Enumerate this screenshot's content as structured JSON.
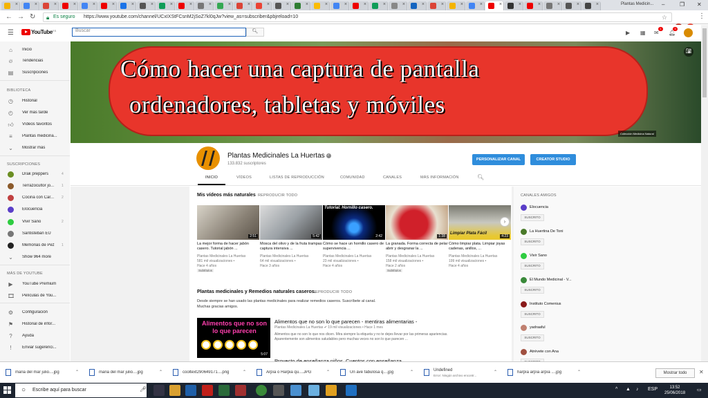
{
  "browser": {
    "window_title": "Plantas Medicin...",
    "address": {
      "secure_label": "Es seguro",
      "url": "https://www.youtube.com/channel/UCxIXStFCsnM2jSoZ7kl0qJw?view_as=subscriber&pbjreload=10"
    }
  },
  "youtube": {
    "logo_text": "YouTube",
    "logo_region": "ES",
    "search_placeholder": "Buscar",
    "notification_count": "3",
    "messages_count": "1"
  },
  "sidebar": {
    "main": [
      {
        "label": "Inicio",
        "icon": "home-icon"
      },
      {
        "label": "Tendencias",
        "icon": "trending-icon"
      },
      {
        "label": "Suscripciones",
        "icon": "subscriptions-icon"
      }
    ],
    "library_header": "BIBLIOTECA",
    "library": [
      {
        "label": "Historial",
        "icon": "history-icon"
      },
      {
        "label": "Ver más tarde",
        "icon": "clock-icon"
      },
      {
        "label": "Vídeos favoritos",
        "icon": "thumbs-up-icon"
      },
      {
        "label": "Plantas medicina...",
        "icon": "playlist-icon"
      },
      {
        "label": "Mostrar más",
        "icon": "chevron-down-icon"
      }
    ],
    "subs_header": "SUSCRIPCIONES",
    "subscriptions": [
      {
        "label": "Drak preppers",
        "count": "4",
        "color": "#6b8e23"
      },
      {
        "label": "Terrazocultor jo...",
        "count": "1",
        "color": "#8b5a2b"
      },
      {
        "label": "Cocina con Car...",
        "count": "2",
        "color": "#c04040"
      },
      {
        "label": "Elocuencia",
        "count": "",
        "color": "#5a3ec8"
      },
      {
        "label": "Vivir Sano",
        "count": "2",
        "color": "#2ecc40"
      },
      {
        "label": "Santisteban EU",
        "count": "",
        "color": "#777777"
      },
      {
        "label": "Memorias de Pez",
        "count": "1",
        "color": "#222222"
      },
      {
        "label": "Show 964 more",
        "count": "",
        "color": ""
      }
    ],
    "more_header": "MÁS DE YOUTUBE",
    "more": [
      {
        "label": "YouTube Premium",
        "icon": "youtube-icon"
      },
      {
        "label": "Películas de You...",
        "icon": "film-icon"
      }
    ],
    "settings": [
      {
        "label": "Configuración",
        "icon": "gear-icon"
      },
      {
        "label": "Historial de infor...",
        "icon": "flag-icon"
      },
      {
        "label": "Ayuda",
        "icon": "help-icon"
      },
      {
        "label": "Enviar sugerenci...",
        "icon": "feedback-icon"
      }
    ]
  },
  "banner": {
    "line1": "Cómo hacer una captura de pantalla",
    "line2": "ordenadores, tabletas y móviles",
    "collection": "Colección Medicina Natural"
  },
  "channel": {
    "name": "Plantas Medicinales La Huertas",
    "subscribers": "133.832 suscriptores",
    "customize_label": "PERSONALIZAR CANAL",
    "studio_label": "CREATOR STUDIO",
    "tabs": [
      "INICIO",
      "VÍDEOS",
      "LISTAS DE REPRODUCCIÓN",
      "COMUNIDAD",
      "CANALES",
      "MÁS INFORMACIÓN"
    ]
  },
  "section1": {
    "title": "Mis vídeos más naturales",
    "play_all": "REPRODUCIR TODO",
    "videos": [
      {
        "title": "La mejor forma de hacer jabón casero. Tutorial jabón ...",
        "channel": "Plantas Medicinales La Huertas",
        "views": "581 mil visualizaciones •",
        "age": "Hace 4 años",
        "duration": "2:51",
        "tag": "Subtítulos"
      },
      {
        "title": "Mosca del olivo y de la fruta trampas captura intensiva ...",
        "channel": "Plantas Medicinales La Huertas",
        "views": "64 mil visualizaciones •",
        "age": "Hace 3 años",
        "duration": "5:42",
        "tag": ""
      },
      {
        "title": "Cómo se hace un hornillo casero de supervivencia ...",
        "channel": "Plantas Medicinales La Huertas",
        "views": "23 mil visualizaciones •",
        "age": "Hace 4 años",
        "duration": "2:42",
        "tag": "",
        "thumb_text": "Tutorial. Hornillo casero."
      },
      {
        "title": "La granada. Forma correcta de pelar abrir y desgranar la ...",
        "channel": "Plantas Medicinales La Huertas",
        "views": "158 mil visualizaciones •",
        "age": "Hace 2 años",
        "duration": "1:38",
        "tag": "Subtítulos"
      },
      {
        "title": "Cómo limpiar plata. Limpiar joyas cadenas, anillos, ...",
        "channel": "Plantas Medicinales La Huertas",
        "views": "199 mil visualizaciones •",
        "age": "Hace 4 años",
        "duration": "4:23",
        "tag": "",
        "thumb_text": "Limpiar Plata Fácil"
      }
    ]
  },
  "section2": {
    "title": "Plantas medicinales y Remedios naturales caseros.",
    "play_all": "REPRODUCIR TODO",
    "description": "Desde siempre se han usado las plantas medicinales para realizar remedios caseros. Suscríbete al canal. Muchas gracias amigos.",
    "feature": {
      "thumb_text": "Alimentos que no son lo que parecen",
      "duration": "5:07",
      "title": "Alimentos que no son lo que parecen - mentiras alimentarias -",
      "meta": "Plantas Medicinales La Huertas  ✔  19 mil visualizaciones • Hace 1 mes",
      "description": "Alimentos que no son lo que nos dicen. Mira siempre la etiqueta y no te dejes llevar por las primeras apariencias. Aparentemente son alimentos saludables pero muchas veces no son lo que parecen ...",
      "next_title": "Proyecto de enseñanza niños. Cuentos con enseñanza"
    }
  },
  "related": {
    "header": "CANALES AMIGOS",
    "button_label": "SUSCRITO",
    "channels": [
      {
        "name": "Elocuencia",
        "color": "#5a3ec8"
      },
      {
        "name": "La Huertina De Toni",
        "color": "#4a7a2a"
      },
      {
        "name": "Vivir Sano",
        "color": "#2ecc40"
      },
      {
        "name": "El Mundo Medicinal - V...",
        "color": "#3a8a3a"
      },
      {
        "name": "Instituto Comenius",
        "color": "#8a1a1a"
      },
      {
        "name": "yadraaful",
        "color": "#c08070"
      },
      {
        "name": "Atrévete con Ana",
        "color": "#a05040"
      }
    ]
  },
  "downloads": {
    "items": [
      {
        "name": "maria del mar julio....jpg",
        "sub": ""
      },
      {
        "name": "maria del mar julio....jpg",
        "sub": ""
      },
      {
        "name": "cooltext290649171....png",
        "sub": ""
      },
      {
        "name": "Arpía o Harpia qu....JPG",
        "sub": ""
      },
      {
        "name": "Un ave fabulosa q....jpg",
        "sub": ""
      },
      {
        "name": "Undefined",
        "sub": "Error: Ningún archivo encontr..."
      },
      {
        "name": "harpía arpía arpía ....jpg",
        "sub": ""
      }
    ],
    "show_all": "Mostrar todo"
  },
  "taskbar": {
    "search_placeholder": "Escribe aquí para buscar",
    "time": "13:52",
    "date": "25/06/2018"
  }
}
